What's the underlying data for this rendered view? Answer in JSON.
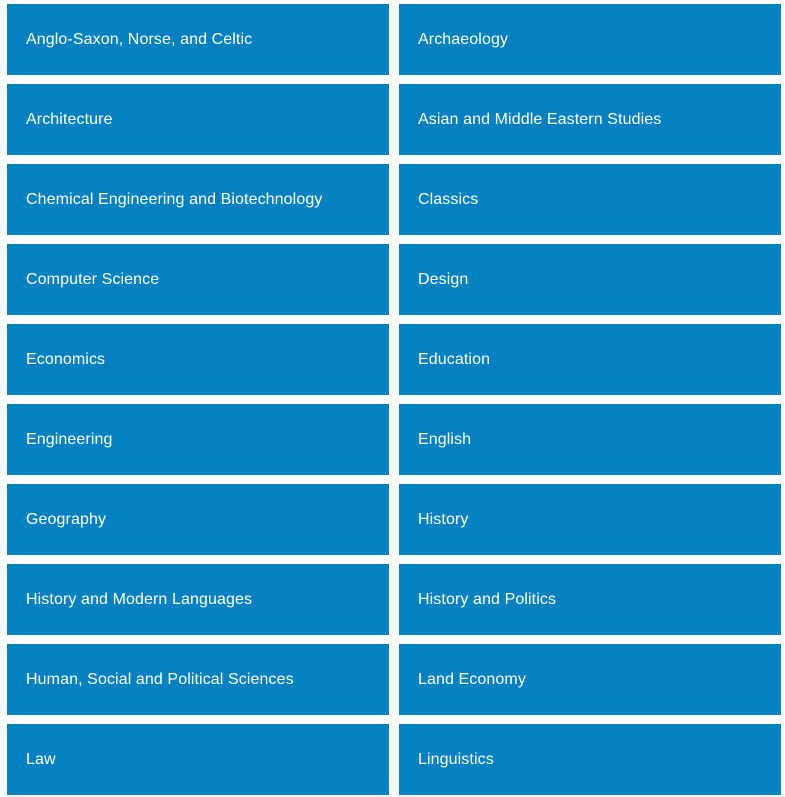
{
  "theme": {
    "tile_color": "#0580c0",
    "tile_text_color": "#ffffff",
    "page_background": "#fdfdfd"
  },
  "subject_grid": {
    "columns": 2,
    "tiles": [
      {
        "label": "Anglo-Saxon, Norse, and Celtic"
      },
      {
        "label": "Archaeology"
      },
      {
        "label": "Architecture"
      },
      {
        "label": "Asian and Middle Eastern Studies"
      },
      {
        "label": "Chemical Engineering and Biotechnology"
      },
      {
        "label": "Classics"
      },
      {
        "label": "Computer Science"
      },
      {
        "label": "Design"
      },
      {
        "label": "Economics"
      },
      {
        "label": "Education"
      },
      {
        "label": "Engineering"
      },
      {
        "label": "English"
      },
      {
        "label": "Geography"
      },
      {
        "label": "History"
      },
      {
        "label": "History and Modern Languages"
      },
      {
        "label": "History and Politics"
      },
      {
        "label": "Human, Social and Political Sciences"
      },
      {
        "label": "Land Economy"
      },
      {
        "label": "Law"
      },
      {
        "label": "Linguistics"
      }
    ]
  }
}
